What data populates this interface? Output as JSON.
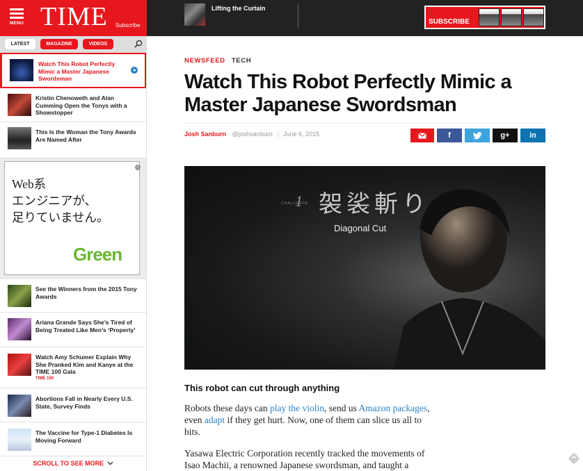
{
  "header": {
    "menu_label": "MENU",
    "logo": "TIME",
    "subscribe_label": "Subscribe",
    "promo_title": "Lifting the Curtain",
    "banner_subscribe": "SUBSCRIBE"
  },
  "sidebar": {
    "tabs": [
      "LATEST",
      "MAGAZINE",
      "VIDEOS"
    ],
    "stories": [
      {
        "title": "Watch This Robot Perfectly Mimic a Master Japanese Swordsman",
        "active": true
      },
      {
        "title": "Kristin Chenoweth and Alan Cumming Open the Tonys with a Showstopper"
      },
      {
        "title": "This Is the Woman the Tony Awards Are Named After"
      },
      {
        "title": "See the Winners from the 2015 Tony Awards"
      },
      {
        "title": "Ariana Grande Says She’s Tired of Being Treated Like Men’s ‘Property’"
      },
      {
        "title": "Watch Amy Schumer Explain Why She Pranked Kim and Kanye at the TIME 100 Gala",
        "tag": "TIME 100"
      },
      {
        "title": "Abortions Fall in Nearly Every U.S. State, Survey Finds"
      },
      {
        "title": "The Vaccine for Type-1 Diabetes Is Moving Forward"
      }
    ],
    "ad": {
      "copy": "Web系\nエンジニアが、\n足りていません。",
      "logo": "Green",
      "info": "i"
    },
    "scroll_more": "SCROLL TO SEE MORE"
  },
  "article": {
    "section": "NEWSFEED",
    "topic": "TECH",
    "headline": "Watch This Robot Perfectly Mimic a Master Japanese Swordsman",
    "author": "Josh Sanburn",
    "handle": "@joshsanburn",
    "separator": "|",
    "date": "June 6, 2015",
    "share": {
      "email": "✉",
      "facebook": "f",
      "twitter": "🐦",
      "gplus": "g+",
      "linkedin": "in"
    },
    "video": {
      "challenge": "CHALLENGE",
      "number": "1",
      "kanji": "袈裟斬り",
      "caption": "Diagonal Cut"
    },
    "subhead": "This robot can cut through anything",
    "para1": {
      "t1": "Robots these days can ",
      "link1": "play the violin",
      "t2": ", send us ",
      "link2": "Amazon packages",
      "t3": ", even ",
      "link3": "adapt",
      "t4": " if they get hurt. Now, one of them can slice us all to bits."
    },
    "para2": "Yasawa Electric Corporation recently tracked the movements of Isao Machii, a renowned Japanese swordsman, and taught a"
  },
  "colors": {
    "brand_red": "#e6171d",
    "link_blue": "#2a82c7",
    "topbar": "#222222"
  }
}
